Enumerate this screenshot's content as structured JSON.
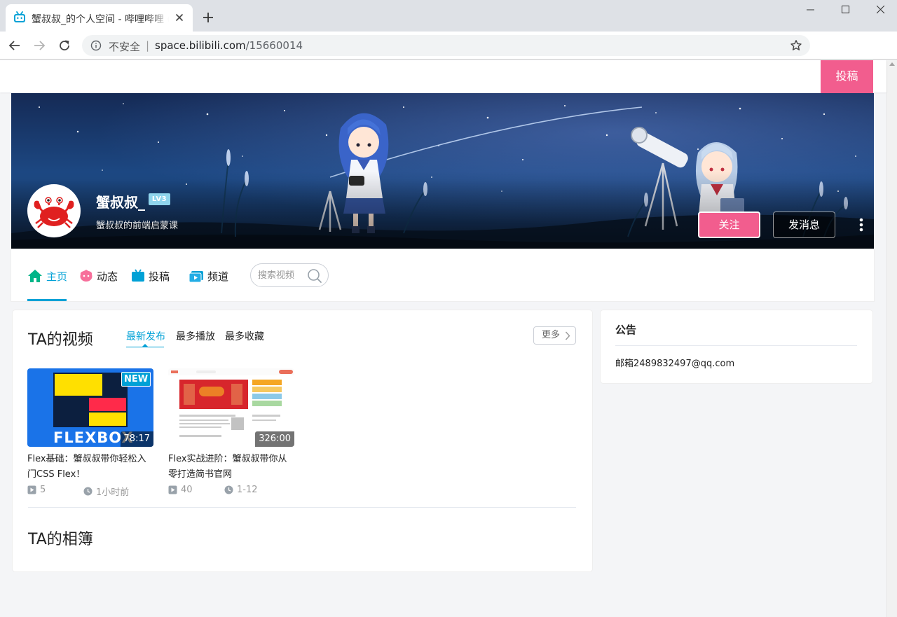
{
  "browser": {
    "tab_title": "蟹叔叔_的个人空间 - 哔哩哔哩 (",
    "security_text": "不安全",
    "url_separator": "|",
    "url_host": "space.bilibili.com",
    "url_path": "/15660014"
  },
  "header": {
    "upload_label": "投稿"
  },
  "profile": {
    "username": "蟹叔叔_",
    "level": "LV3",
    "sign": "蟹叔叔的前端启蒙课",
    "follow_label": "关注",
    "message_label": "发消息"
  },
  "nav": {
    "items": [
      {
        "label": "主页",
        "icon": "home-icon",
        "active": true
      },
      {
        "label": "动态",
        "icon": "dynamic-icon"
      },
      {
        "label": "投稿",
        "icon": "tv-icon"
      },
      {
        "label": "频道",
        "icon": "channel-icon"
      }
    ],
    "search_placeholder": "搜索视频"
  },
  "videos_section": {
    "title": "TA的视频",
    "tabs": [
      "最新发布",
      "最多播放",
      "最多收藏"
    ],
    "more_label": "更多",
    "videos": [
      {
        "badge": "NEW",
        "cover_text": "FLEXBOX",
        "duration": "78:17",
        "title": "Flex基础：蟹叔叔带你轻松入门CSS Flex！",
        "plays": "5",
        "time": "1小时前"
      },
      {
        "duration": "326:00",
        "title": "Flex实战进阶：蟹叔叔带你从零打造简书官网",
        "plays": "40",
        "time": "1-12"
      }
    ]
  },
  "album_section": {
    "title": "TA的相簿"
  },
  "notice": {
    "title": "公告",
    "text": "邮箱2489832497@qq.com"
  },
  "colors": {
    "bilibili_blue": "#00a1d6",
    "bilibili_pink": "#f25d8e"
  }
}
